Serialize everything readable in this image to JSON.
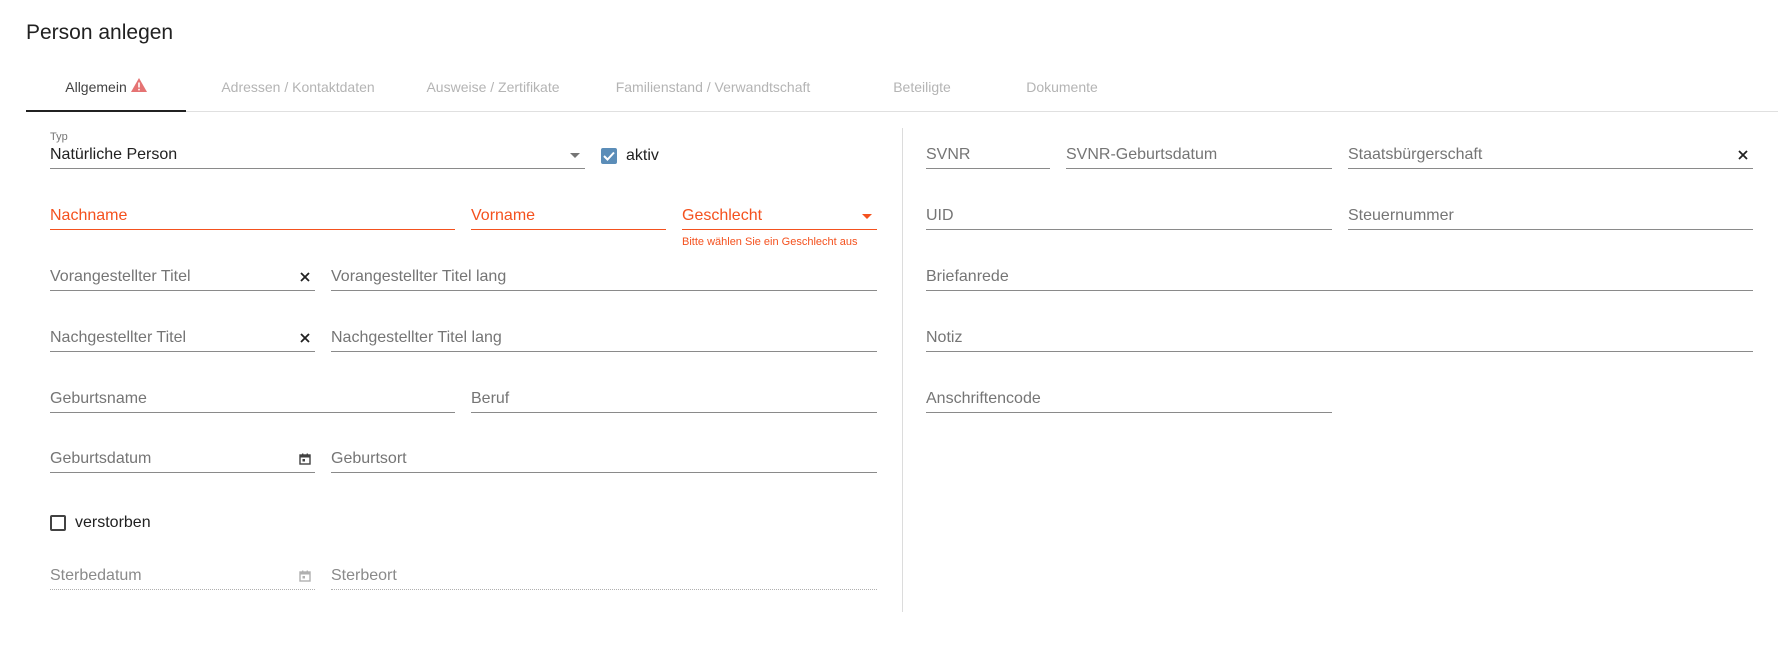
{
  "page": {
    "title": "Person anlegen"
  },
  "tabs": [
    {
      "label": "Allgemein"
    },
    {
      "label": "Adressen / Kontaktdaten"
    },
    {
      "label": "Ausweise / Zertifikate"
    },
    {
      "label": "Familienstand / Verwandtschaft"
    },
    {
      "label": "Beteiligte"
    },
    {
      "label": "Dokumente"
    }
  ],
  "left": {
    "typ": {
      "label": "Typ",
      "value": "Natürliche Person"
    },
    "aktiv": {
      "label": "aktiv",
      "checked": true
    },
    "nachname": {
      "placeholder": "Nachname"
    },
    "vorname": {
      "placeholder": "Vorname"
    },
    "geschlecht": {
      "placeholder": "Geschlecht",
      "error": "Bitte wählen Sie ein Geschlecht aus"
    },
    "vorangestellter_titel": {
      "placeholder": "Vorangestellter Titel"
    },
    "vorangestellter_titel_lang": {
      "placeholder": "Vorangestellter Titel lang"
    },
    "nachgestellter_titel": {
      "placeholder": "Nachgestellter Titel"
    },
    "nachgestellter_titel_lang": {
      "placeholder": "Nachgestellter Titel lang"
    },
    "geburtsname": {
      "placeholder": "Geburtsname"
    },
    "beruf": {
      "placeholder": "Beruf"
    },
    "geburtsdatum": {
      "placeholder": "Geburtsdatum"
    },
    "geburtsort": {
      "placeholder": "Geburtsort"
    },
    "verstorben": {
      "label": "verstorben",
      "checked": false
    },
    "sterbedatum": {
      "placeholder": "Sterbedatum"
    },
    "sterbeort": {
      "placeholder": "Sterbeort"
    }
  },
  "right": {
    "svnr": {
      "placeholder": "SVNR"
    },
    "svnr_geburtsdatum": {
      "placeholder": "SVNR-Geburtsdatum"
    },
    "staatsbuergerschaft": {
      "placeholder": "Staatsbürgerschaft"
    },
    "uid": {
      "placeholder": "UID"
    },
    "steuernummer": {
      "placeholder": "Steuernummer"
    },
    "briefanrede": {
      "placeholder": "Briefanrede"
    },
    "notiz": {
      "placeholder": "Notiz"
    },
    "anschriftencode": {
      "placeholder": "Anschriftencode"
    }
  },
  "colors": {
    "accent": "#5b8db8",
    "error": "#f4511e",
    "warning": "#e57373"
  }
}
